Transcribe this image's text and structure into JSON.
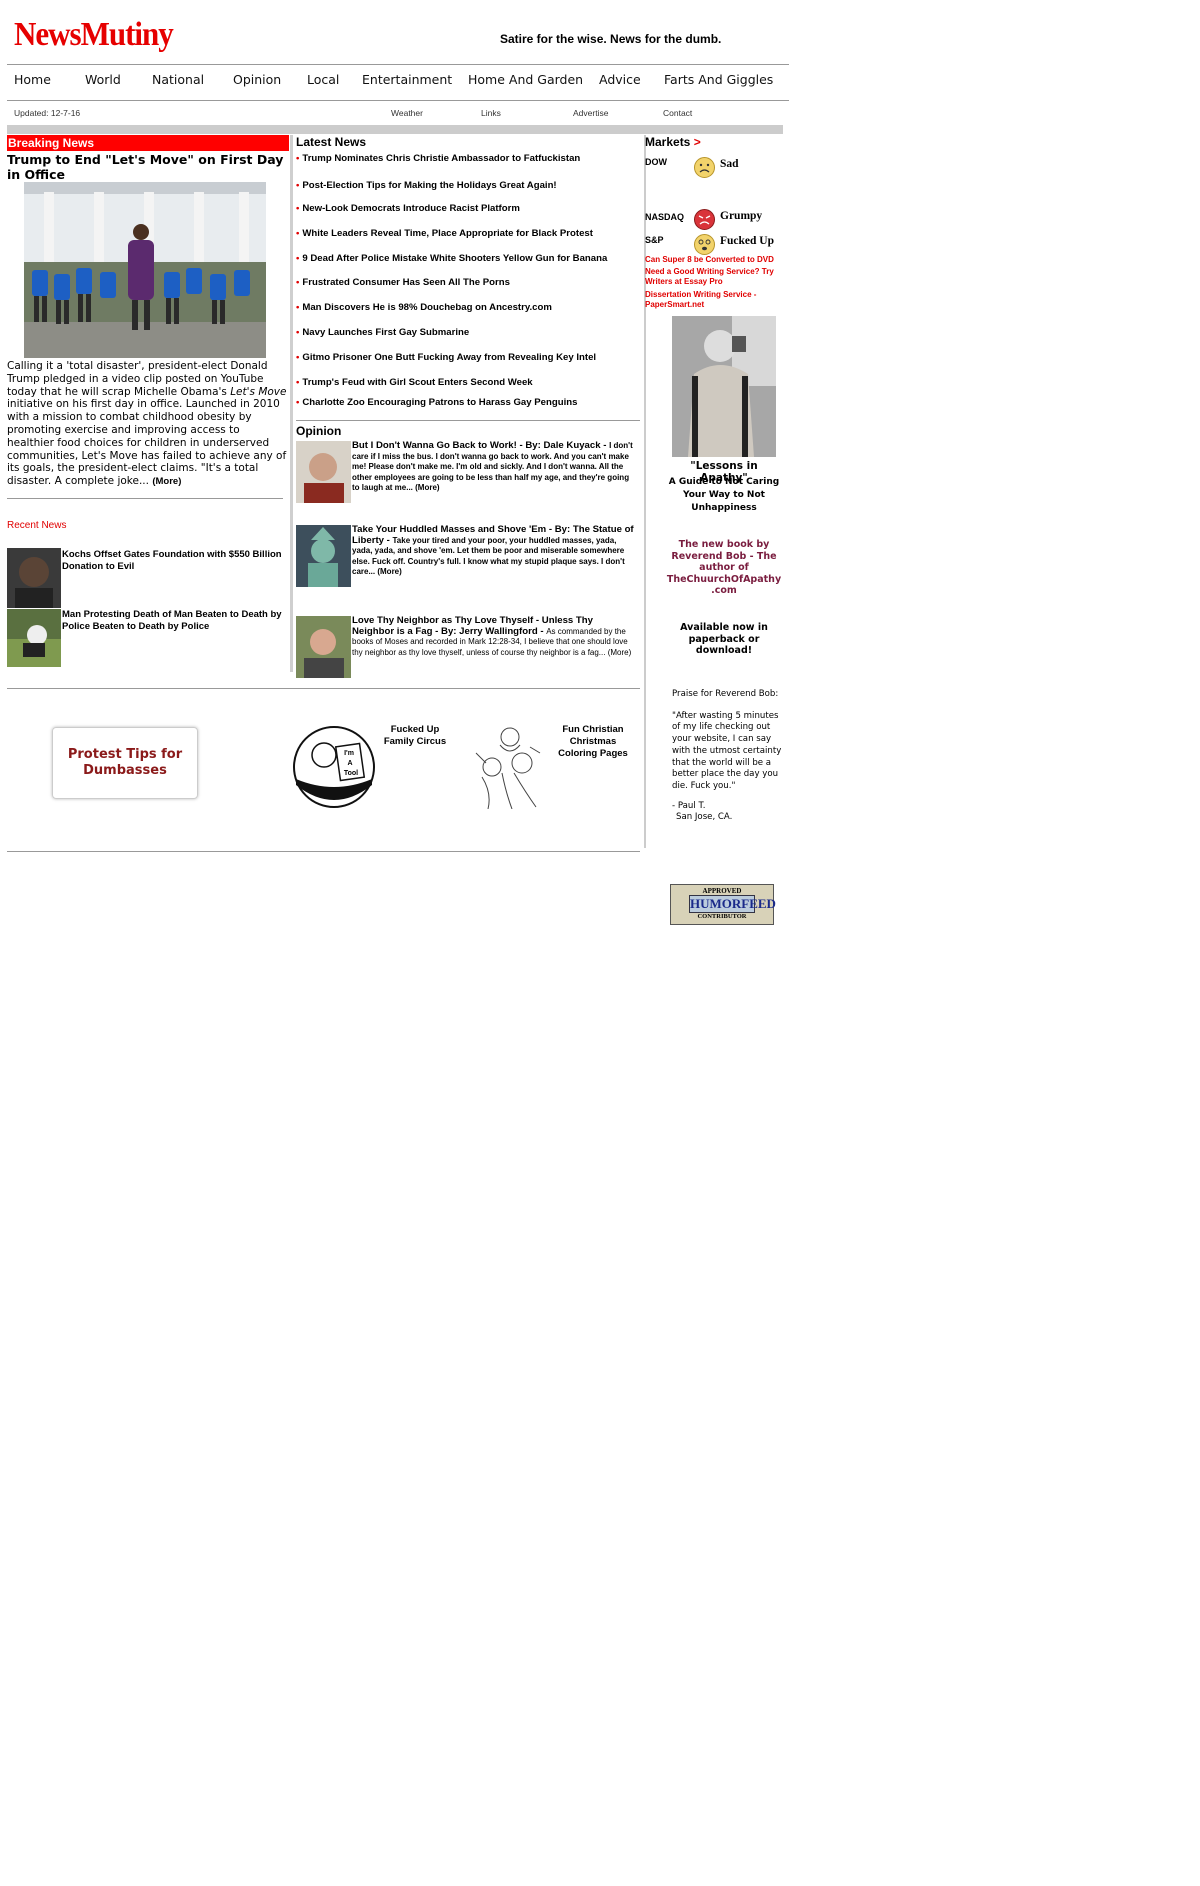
{
  "header": {
    "logo": "NewsMutiny",
    "tagline": "Satire for the wise. News for the dumb."
  },
  "nav": [
    "Home",
    "World",
    "National",
    "Opinion",
    "Local",
    "Entertainment",
    "Home And Garden",
    "Advice",
    "Farts And Giggles"
  ],
  "subnav": {
    "updated": "Updated: 12-7-16",
    "links": [
      "Weather",
      "Links",
      "Advertise",
      "Contact"
    ]
  },
  "breaking": {
    "heading": "Breaking News",
    "title": "Trump to End \"Let's Move\" on First Day in Office",
    "text_before": "Calling it a 'total disaster', president-elect Donald Trump pledged in a video clip posted on YouTube today that he will scrap Michelle Obama's ",
    "text_italic": "Let's Move",
    "text_after": " initiative on his first day in office. Launched in 2010 with a mission to combat childhood obesity by promoting exercise and improving access to healthier food choices for children in underserved communities, Let's Move has failed to achieve any of its goals, the president-elect claims. \"It's a total disaster. A complete joke... ",
    "more": "(More)"
  },
  "recent": {
    "heading": "Recent News",
    "items": [
      "Kochs Offset Gates Foundation with $550 Billion Donation to Evil",
      "Man Protesting Death of Man Beaten to Death by Police Beaten to Death by Police"
    ]
  },
  "latest": {
    "heading": "Latest News",
    "items": [
      "Trump Nominates Chris Christie Ambassador to Fatfuckistan",
      "Post-Election Tips for Making the Holidays Great Again!",
      "New-Look Democrats Introduce Racist Platform",
      "White Leaders Reveal Time, Place Appropriate for Black Protest",
      "9 Dead After Police Mistake White Shooters Yellow Gun for Banana",
      "Frustrated Consumer Has Seen All The Porns",
      "Man Discovers He is 98% Douchebag on Ancestry.com",
      "Navy Launches First Gay Submarine",
      "Gitmo Prisoner One Butt Fucking Away from Revealing Key Intel",
      "Trump's Feud with Girl Scout Enters Second Week",
      "Charlotte Zoo Encouraging Patrons to Harass Gay Penguins"
    ]
  },
  "opinion": {
    "heading": "Opinion",
    "items": [
      {
        "title": "But I Don't Wanna Go Back to Work! - By: Dale Kuyack - ",
        "body": "I don't care if I miss the bus. I don't wanna go back to work. And you can't make me! Please don't make me. I'm old and sickly. And I don't wanna. All the other employees are going to be less than half my age, and they're going to laugh at me... (More)"
      },
      {
        "title": "Take Your Huddled Masses and Shove 'Em - By: The Statue of Liberty - ",
        "body": "Take your tired and your poor, your huddled masses, yada, yada, yada, and shove 'em. Let them be poor and miserable somewhere else. Fuck off. Country's full. I know what my stupid plaque says. I don't care... (More)"
      },
      {
        "title": "Love Thy Neighbor as Thy Love Thyself - Unless Thy Neighbor is a Fag - By: Jerry Wallingford - ",
        "body": "As commanded by the books of Moses and recorded in Mark 12:28-34, I believe that one should love thy neighbor as thy love thyself, unless of course thy neighbor is a fag... (More)"
      }
    ]
  },
  "markets": {
    "heading": "Markets",
    "arrow": ">",
    "rows": [
      {
        "label": "DOW",
        "status": "Sad",
        "face_color": "#f2d36b"
      },
      {
        "label": "NASDAQ",
        "status": "Grumpy",
        "face_color": "#d9343a"
      },
      {
        "label": "S&P",
        "status": "Fucked Up",
        "face_color": "#f2d36b"
      }
    ],
    "links": [
      "Can Super 8 be Converted to DVD",
      "Need a Good Writing Service? Try Writers at Essay Pro",
      "Dissertation Writing Service - PaperSmart.net"
    ]
  },
  "book": {
    "title": "\"Lessons in Apathy\"",
    "subtitle": "A Guide to Not Caring Your Way to Not Unhappiness",
    "author": "The new book by Reverend Bob - The author of TheChuurchOfApathy .com",
    "available": "Available now in paperback or download!",
    "praise_head": "Praise for Reverend Bob:",
    "praise_quote": "\"After wasting 5 minutes of my life checking out your website, I can say with the utmost certainty that the world will be a better place the day you die. Fuck you.\"",
    "praise_attr1": "- Paul T.",
    "praise_attr2": "San Jose, CA."
  },
  "promos": {
    "protest": "Protest Tips for Dumbasses",
    "circus": "Fucked Up Family Circus",
    "coloring": "Fun Christian Christmas Coloring Pages",
    "circus_sign": "I'm A Tool"
  },
  "badge": {
    "top": "APPROVED",
    "name": "HUMORFEED",
    "bottom": "CONTRIBUTOR"
  }
}
